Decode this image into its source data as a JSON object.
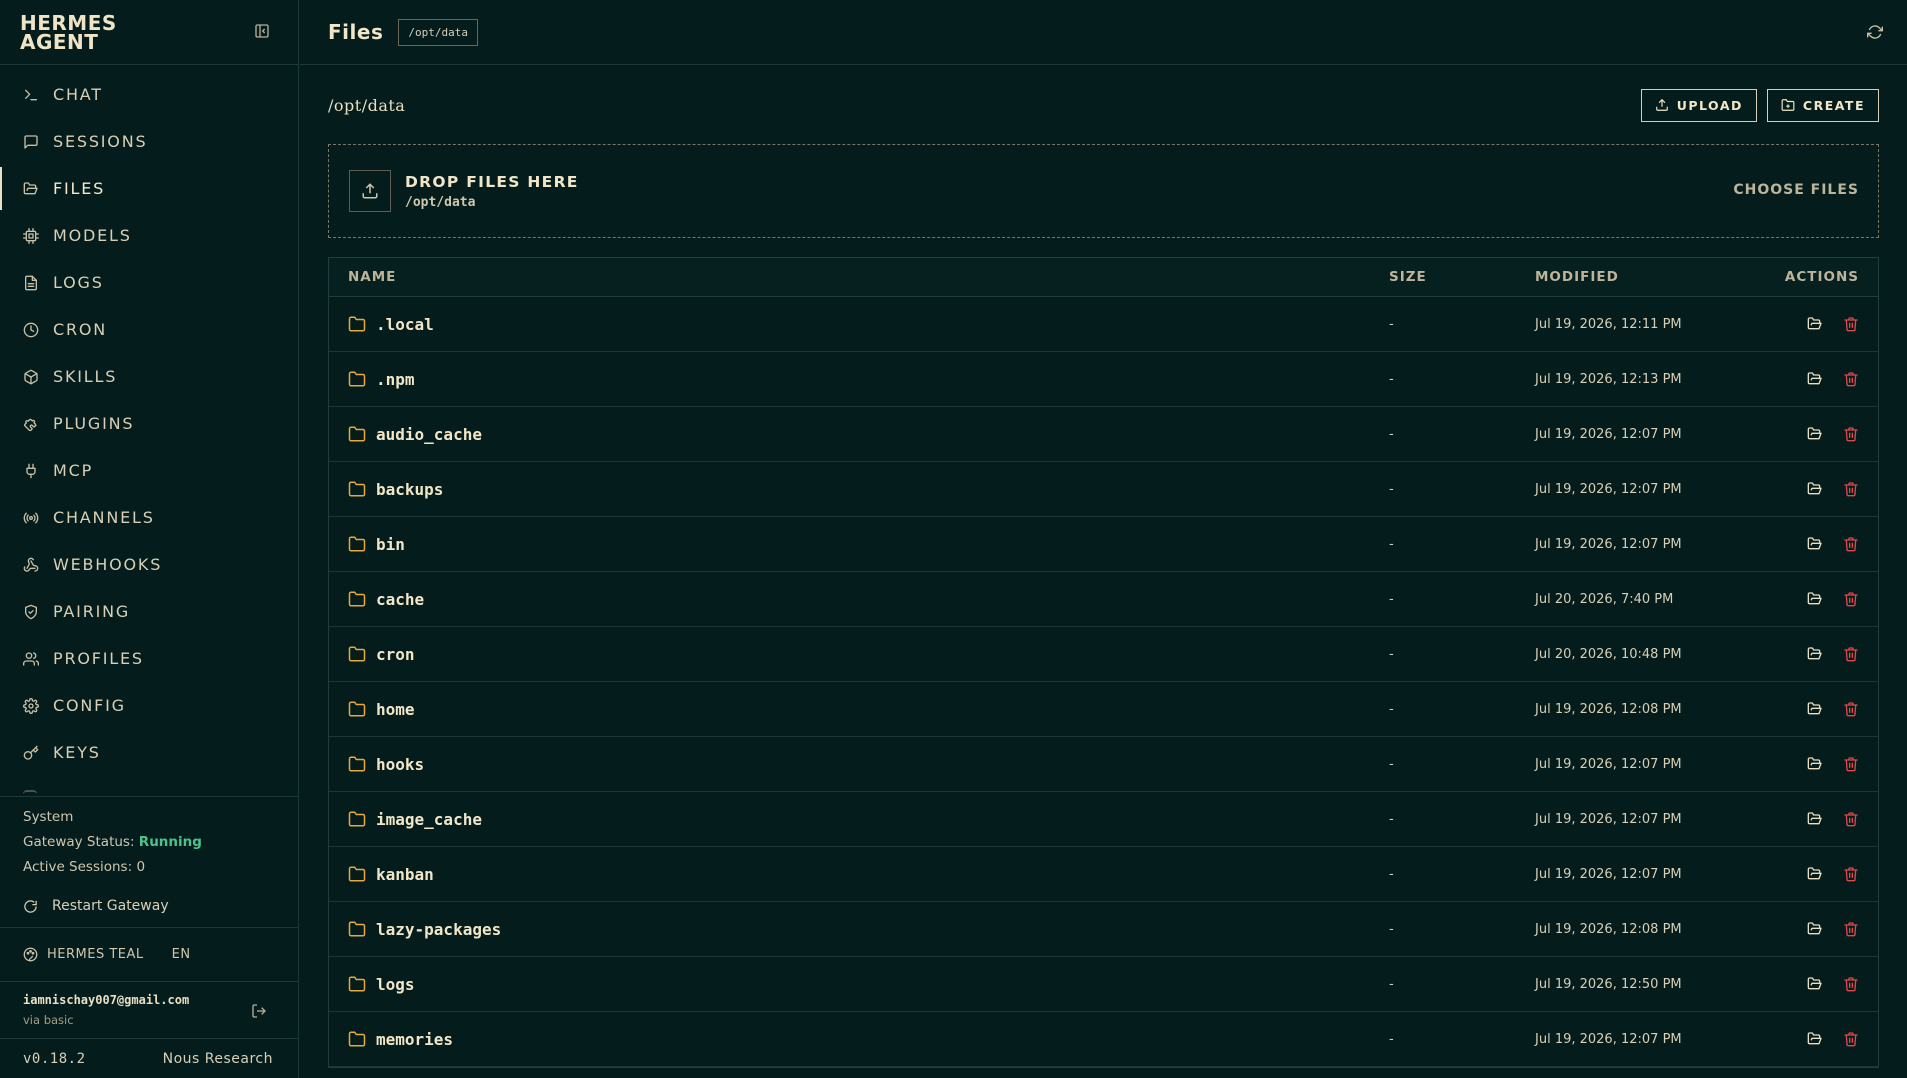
{
  "sidebar": {
    "brand": "HERMES AGENT",
    "nav": [
      {
        "label": "CHAT",
        "icon": "terminal-icon",
        "active": false
      },
      {
        "label": "SESSIONS",
        "icon": "message-square-icon",
        "active": false
      },
      {
        "label": "FILES",
        "icon": "folder-open-icon",
        "active": true
      },
      {
        "label": "MODELS",
        "icon": "cpu-icon",
        "active": false
      },
      {
        "label": "LOGS",
        "icon": "file-text-icon",
        "active": false
      },
      {
        "label": "CRON",
        "icon": "clock-icon",
        "active": false
      },
      {
        "label": "SKILLS",
        "icon": "package-icon",
        "active": false
      },
      {
        "label": "PLUGINS",
        "icon": "puzzle-icon",
        "active": false
      },
      {
        "label": "MCP",
        "icon": "plug-icon",
        "active": false
      },
      {
        "label": "CHANNELS",
        "icon": "radio-icon",
        "active": false
      },
      {
        "label": "WEBHOOKS",
        "icon": "webhook-icon",
        "active": false
      },
      {
        "label": "PAIRING",
        "icon": "shield-check-icon",
        "active": false
      },
      {
        "label": "PROFILES",
        "icon": "users-icon",
        "active": false
      },
      {
        "label": "CONFIG",
        "icon": "gear-icon",
        "active": false
      },
      {
        "label": "KEYS",
        "icon": "key-icon",
        "active": false
      }
    ],
    "system": {
      "heading": "System",
      "gateway_label": "Gateway Status:",
      "gateway_value": "Running",
      "sessions_label": "Active Sessions:",
      "sessions_value": "0",
      "restart_label": "Restart Gateway"
    },
    "theme_label": "HERMES TEAL",
    "lang_label": "EN",
    "user": {
      "email": "iamnischay007@gmail.com",
      "via": "via basic"
    },
    "version": "v0.18.2",
    "vendor": "Nous Research"
  },
  "topbar": {
    "title": "Files",
    "path_badge": "/opt/data"
  },
  "main": {
    "path": "/opt/data",
    "upload_label": "UPLOAD",
    "create_label": "CREATE",
    "dropzone": {
      "title": "DROP FILES HERE",
      "path": "/opt/data",
      "choose_label": "CHOOSE FILES"
    },
    "table": {
      "headers": {
        "name": "NAME",
        "size": "SIZE",
        "modified": "MODIFIED",
        "actions": "ACTIONS"
      },
      "rows": [
        {
          "name": ".local",
          "size": "-",
          "modified": "Jul 19, 2026, 12:11 PM"
        },
        {
          "name": ".npm",
          "size": "-",
          "modified": "Jul 19, 2026, 12:13 PM"
        },
        {
          "name": "audio_cache",
          "size": "-",
          "modified": "Jul 19, 2026, 12:07 PM"
        },
        {
          "name": "backups",
          "size": "-",
          "modified": "Jul 19, 2026, 12:07 PM"
        },
        {
          "name": "bin",
          "size": "-",
          "modified": "Jul 19, 2026, 12:07 PM"
        },
        {
          "name": "cache",
          "size": "-",
          "modified": "Jul 20, 2026, 7:40 PM"
        },
        {
          "name": "cron",
          "size": "-",
          "modified": "Jul 20, 2026, 10:48 PM"
        },
        {
          "name": "home",
          "size": "-",
          "modified": "Jul 19, 2026, 12:08 PM"
        },
        {
          "name": "hooks",
          "size": "-",
          "modified": "Jul 19, 2026, 12:07 PM"
        },
        {
          "name": "image_cache",
          "size": "-",
          "modified": "Jul 19, 2026, 12:07 PM"
        },
        {
          "name": "kanban",
          "size": "-",
          "modified": "Jul 19, 2026, 12:07 PM"
        },
        {
          "name": "lazy-packages",
          "size": "-",
          "modified": "Jul 19, 2026, 12:08 PM"
        },
        {
          "name": "logs",
          "size": "-",
          "modified": "Jul 19, 2026, 12:50 PM"
        },
        {
          "name": "memories",
          "size": "-",
          "modified": "Jul 19, 2026, 12:07 PM"
        }
      ]
    }
  },
  "colors": {
    "background": "#041d1c",
    "text": "#e9dfc4",
    "folder": "#e7a93b",
    "delete": "#e2474b",
    "running": "#4cc38a"
  }
}
